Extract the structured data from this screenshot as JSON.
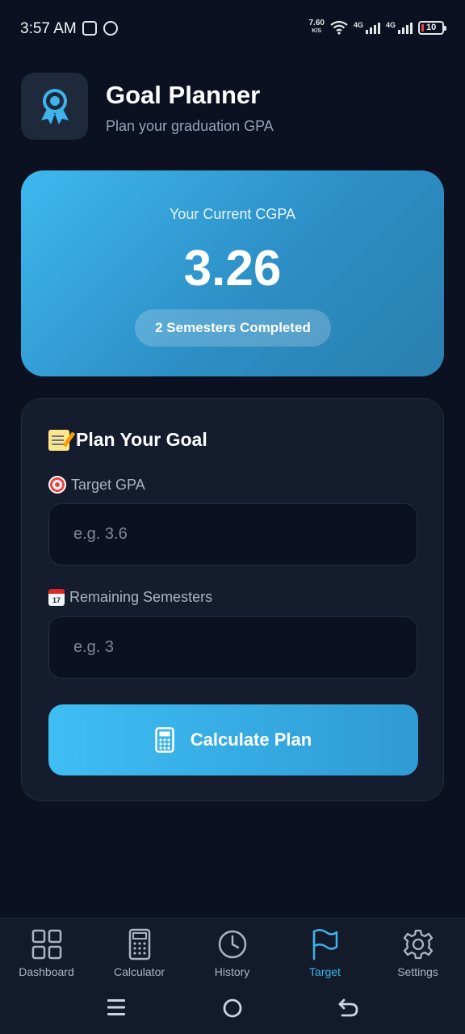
{
  "status_bar": {
    "time": "3:57 AM",
    "net_speed_value": "7.60",
    "net_speed_unit": "K/S",
    "signal1_label": "4G",
    "signal2_label": "4G",
    "battery": "10"
  },
  "header": {
    "title": "Goal Planner",
    "subtitle": "Plan your graduation GPA",
    "logo_icon": "award-ribbon-icon"
  },
  "cgpa_card": {
    "label": "Your Current CGPA",
    "value": "3.26",
    "badge": "2 Semesters Completed"
  },
  "plan_card": {
    "title": "Plan Your Goal",
    "target_gpa": {
      "label": "Target GPA",
      "placeholder": "e.g. 3.6",
      "value": ""
    },
    "remaining_semesters": {
      "label": "Remaining Semesters",
      "placeholder": "e.g. 3",
      "value": ""
    },
    "calculate_button": "Calculate Plan"
  },
  "bottom_nav": {
    "items": [
      {
        "label": "Dashboard",
        "icon": "grid-icon"
      },
      {
        "label": "Calculator",
        "icon": "calculator-icon"
      },
      {
        "label": "History",
        "icon": "clock-icon"
      },
      {
        "label": "Target",
        "icon": "flag-icon",
        "active": true
      },
      {
        "label": "Settings",
        "icon": "gear-icon"
      }
    ]
  },
  "colors": {
    "background": "#0b1120",
    "accent": "#3fb4ea",
    "card": "#141c2e"
  }
}
